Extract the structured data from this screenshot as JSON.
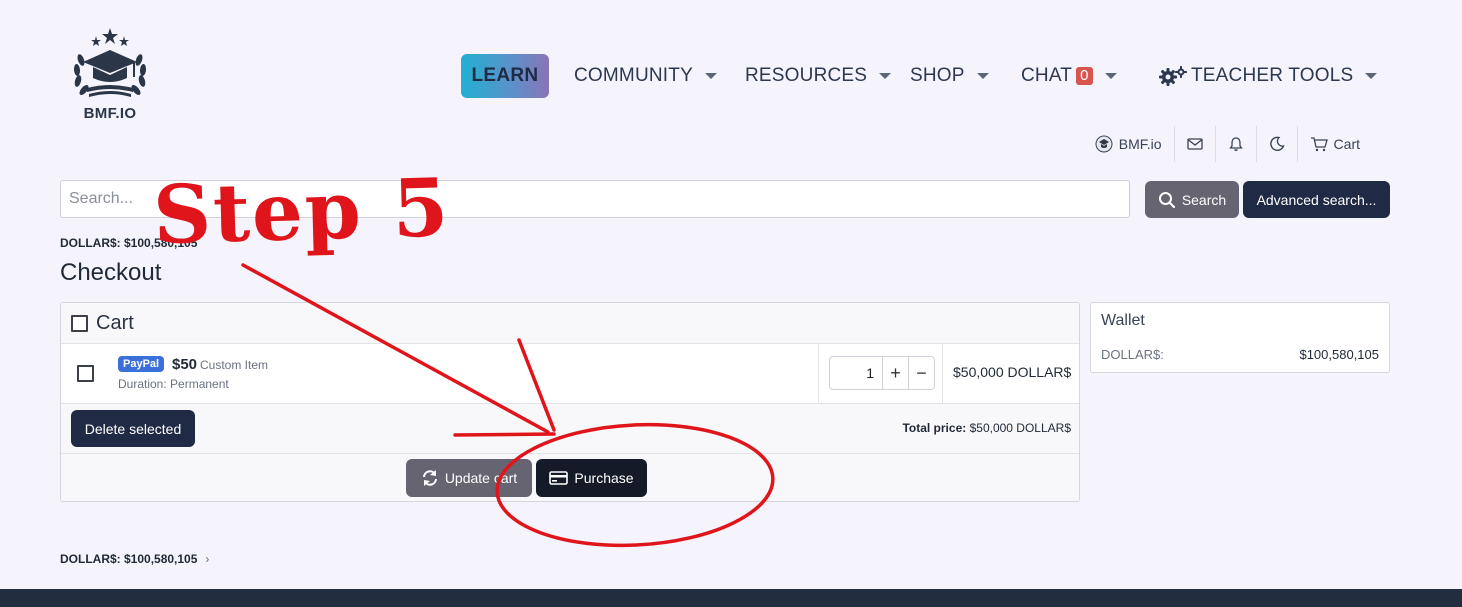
{
  "brand": {
    "logo_text": "BMF.IO"
  },
  "nav": {
    "learn": "LEARN",
    "community": "COMMUNITY",
    "resources": "RESOURCES",
    "shop": "SHOP",
    "chat": "CHAT",
    "chat_count": "0",
    "teacher_tools": "TEACHER TOOLS"
  },
  "util": {
    "account": "BMF.io",
    "cart": "Cart"
  },
  "search": {
    "placeholder": "Search...",
    "button": "Search",
    "advanced": "Advanced search..."
  },
  "balance_top": "DOLLAR$: $100,580,105",
  "page_title": "Checkout",
  "cart": {
    "header": "Cart",
    "item": {
      "badge": "PayPal",
      "price": "$50",
      "type": "Custom Item",
      "duration": "Duration: Permanent",
      "quantity": "1",
      "line_total": "$50,000 DOLLAR$"
    },
    "delete_selected": "Delete selected",
    "total_label": "Total price:",
    "total_value": "$50,000 DOLLAR$",
    "update_cart": "Update cart",
    "purchase": "Purchase"
  },
  "wallet": {
    "title": "Wallet",
    "label": "DOLLAR$:",
    "value": "$100,580,105"
  },
  "balance_bottom": "DOLLAR$: $100,580,105",
  "annotation": {
    "step_text": "Step 5",
    "color": "#e0141b"
  },
  "colors": {
    "background": "#f5f3fb",
    "primary_dark": "#1f2a44",
    "secondary_gray": "#676472",
    "badge_red": "#d9534f",
    "paypal_blue": "#3b6fd9"
  }
}
